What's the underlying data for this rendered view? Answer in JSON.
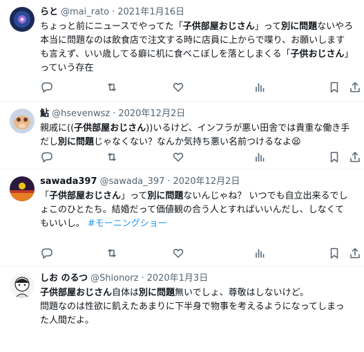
{
  "tweets": [
    {
      "name": "らと",
      "handle": "@mai_rato",
      "date": "2021年1月16日",
      "segments": [
        {
          "t": "ちょっと前にニュースでやってた「",
          "b": false
        },
        {
          "t": "子供部屋おじさん",
          "b": true
        },
        {
          "t": "」って",
          "b": false
        },
        {
          "t": "別に問題",
          "b": true
        },
        {
          "t": "ないやろ\n本当に問題なのは飲食店で注文する時に店員に上からで喋り、お願いします\nも言えず、いい歳してる癖に机に食べこぼしを落としまくる「",
          "b": false
        },
        {
          "t": "子供おじさん",
          "b": true
        },
        {
          "t": "」\nっていう存在",
          "b": false
        }
      ]
    },
    {
      "name": "鮎",
      "handle": "@hsevenwsz",
      "date": "2020年12月2日",
      "segments": [
        {
          "t": "親戚に((",
          "b": false
        },
        {
          "t": "子供部屋おじさん",
          "b": true
        },
        {
          "t": "))いるけど、インフラが悪い田舎では貴重な働き手\nだし",
          "b": false
        },
        {
          "t": "別に問題",
          "b": true
        },
        {
          "t": "じゃなくない？なんか気持ち悪い名前つけるなよ😫",
          "b": false
        }
      ]
    },
    {
      "name": "sawada397",
      "handle": "@sawada_397",
      "date": "2020年12月2日",
      "segments": [
        {
          "t": "「",
          "b": false
        },
        {
          "t": "子供部屋おじさん",
          "b": true
        },
        {
          "t": "」って",
          "b": false
        },
        {
          "t": "別に問題",
          "b": true
        },
        {
          "t": "ないんじゃね？ いつでも自立出来るでし\nょこのひとたち。結婚だって価値観の合う人とすればいいんだし、しなくて\nもいいし。  ",
          "b": false
        },
        {
          "t": "#モーニングショー",
          "b": false,
          "tag": true
        }
      ]
    },
    {
      "name": "しお のるつ",
      "handle": "@Shionorz",
      "date": "2020年1月3日",
      "segments": [
        {
          "t": "子供部屋おじさん",
          "b": true
        },
        {
          "t": "自体は",
          "b": false
        },
        {
          "t": "別に問題",
          "b": true
        },
        {
          "t": "無いでしょ、尊敬はしないけど。\n問題なのは性欲に飢えたあまりに下半身で物事を考えるようになってしまっ\nた人間だよ。",
          "b": false
        }
      ]
    }
  ],
  "separator": "·",
  "icons": [
    "reply-icon",
    "retweet-icon",
    "like-icon",
    "views-icon",
    "bookmark-icon",
    "share-icon"
  ],
  "colors": {
    "text": "#0f1419",
    "secondary": "#536471",
    "hashtag": "#1d9bf0"
  }
}
